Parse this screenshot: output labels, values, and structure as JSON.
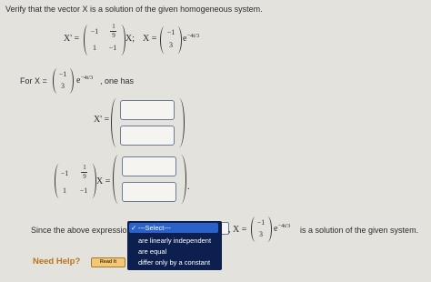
{
  "question": {
    "prompt": "Verify that the vector X is a solution of the given homogeneous system.",
    "system": {
      "lhs": "X' =",
      "matrix": [
        [
          "−1",
          "1/9"
        ],
        [
          "1",
          "−1"
        ]
      ],
      "matrix_frac_num": "1",
      "matrix_frac_den": "9",
      "x_suffix": "X;",
      "x_label": "X =",
      "x_vector": [
        "−1",
        "3"
      ],
      "exp_base": "e",
      "exp_power": "−4t/3"
    },
    "for_line": {
      "prefix": "For X =",
      "vector": [
        "−1",
        "3"
      ],
      "exp_base": "e",
      "exp_power": "−4t/3",
      "suffix": ", one has"
    },
    "xprime_label": "X' =",
    "product": {
      "matrix": [
        [
          "−1",
          "1/9"
        ],
        [
          "1",
          "−1"
        ]
      ],
      "frac_num": "1",
      "frac_den": "9",
      "x_suffix": "X =",
      "trailing": "."
    },
    "conclusion": {
      "prefix": "Since the above expression",
      "suffix_x": ", X =",
      "vector": [
        "−1",
        "3"
      ],
      "exp_base": "e",
      "exp_power": "−4t/3",
      "suffix": "is a solution of the given system."
    }
  },
  "dropdown": {
    "options": [
      "---Select---",
      "are linearly independent",
      "are equal",
      "differ only by a constant"
    ],
    "selected_index": 0,
    "checkmark": "✓"
  },
  "help": {
    "label": "Need Help?",
    "button": "Read It"
  },
  "colors": {
    "background": "#e4e2dc",
    "dropdown_bg": "#0d1f4f",
    "dropdown_highlight": "#2a62c9",
    "help_text": "#b8741a",
    "readit_bg": "#f3c77a"
  }
}
